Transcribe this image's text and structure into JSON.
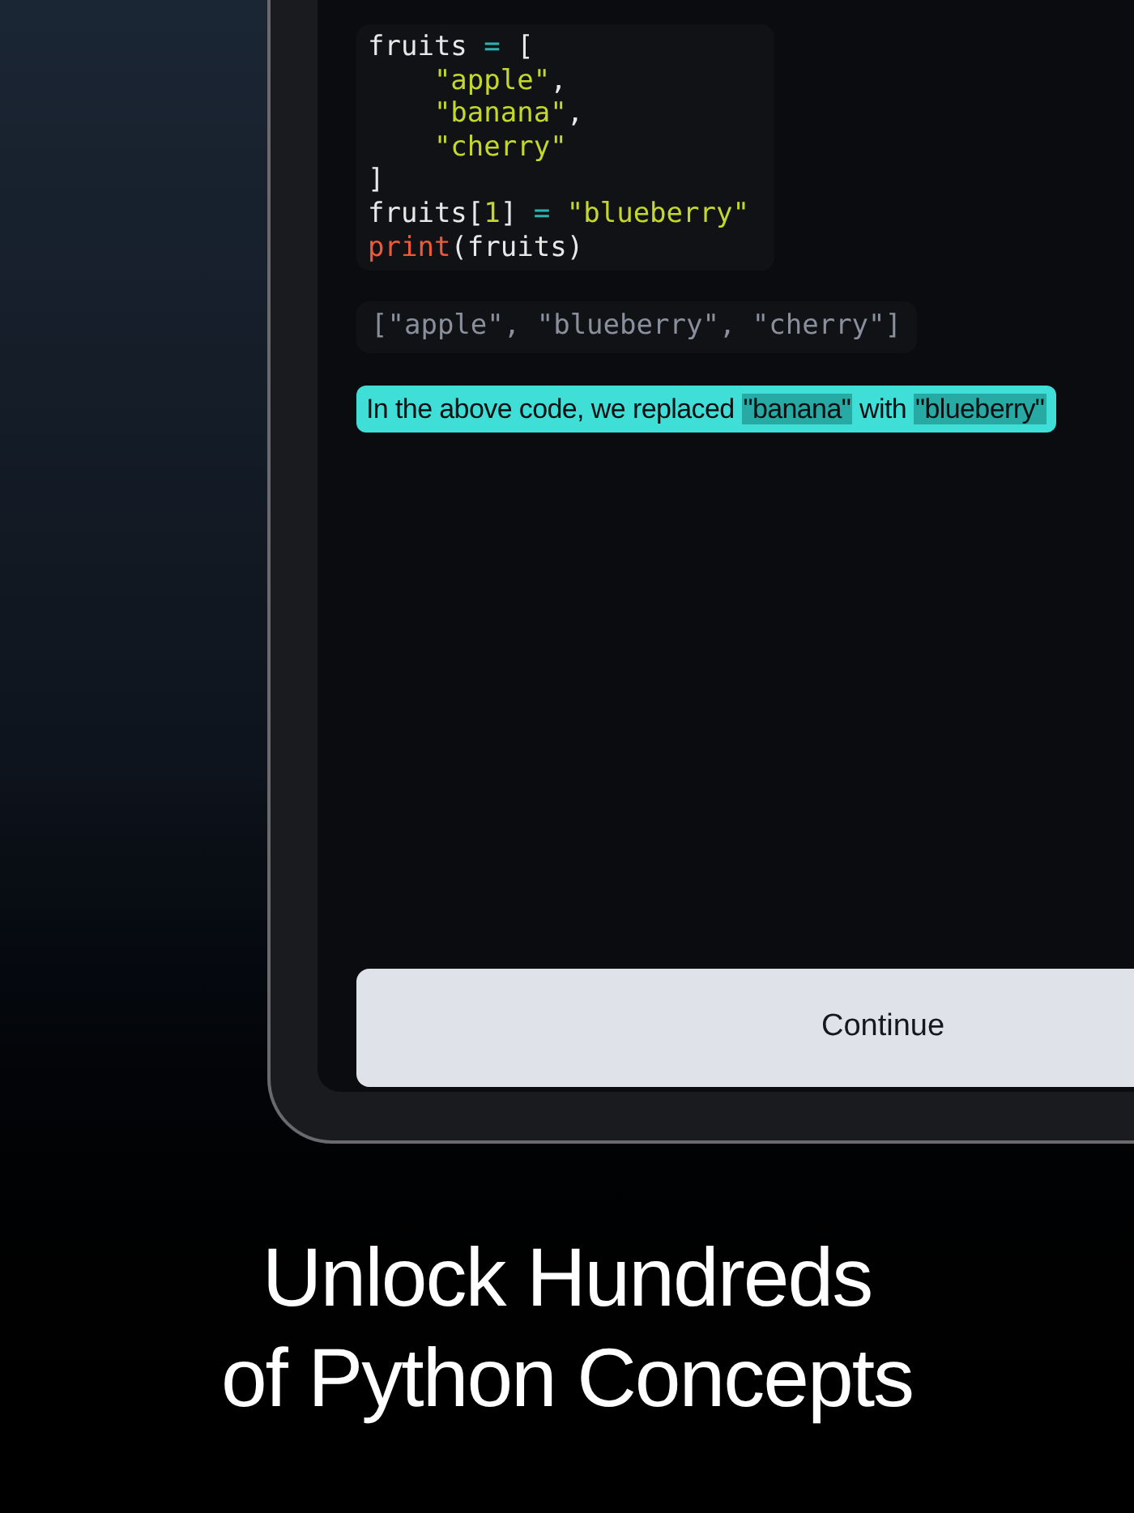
{
  "code_lines": [
    [
      {
        "kind": "name",
        "text": "fruits "
      },
      {
        "kind": "operator",
        "text": "="
      },
      {
        "kind": "plain",
        "text": " ["
      }
    ],
    [
      {
        "kind": "string",
        "text": "    \"apple\""
      },
      {
        "kind": "plain",
        "text": ","
      }
    ],
    [
      {
        "kind": "string",
        "text": "    \"banana\""
      },
      {
        "kind": "plain",
        "text": ","
      }
    ],
    [
      {
        "kind": "string",
        "text": "    \"cherry\""
      }
    ],
    [
      {
        "kind": "plain",
        "text": "]"
      }
    ],
    [
      {
        "kind": "name",
        "text": "fruits["
      },
      {
        "kind": "number",
        "text": "1"
      },
      {
        "kind": "plain",
        "text": "] "
      },
      {
        "kind": "operator",
        "text": "="
      },
      {
        "kind": "string",
        "text": " \"blueberry\""
      }
    ],
    [
      {
        "kind": "keyword",
        "text": "print"
      },
      {
        "kind": "plain",
        "text": "(fruits)"
      }
    ]
  ],
  "output": "[\"apple\", \"blueberry\", \"cherry\"]",
  "explanation": [
    {
      "kind": "text",
      "text": "In the above code, we replaced "
    },
    {
      "kind": "highlight",
      "text": "\"banana\""
    },
    {
      "kind": "text",
      "text": " with "
    },
    {
      "kind": "highlight",
      "text": "\"blueberry\""
    }
  ],
  "continue_button": "Continue",
  "headline": [
    "Unlock Hundreds",
    "of Python Concepts"
  ]
}
